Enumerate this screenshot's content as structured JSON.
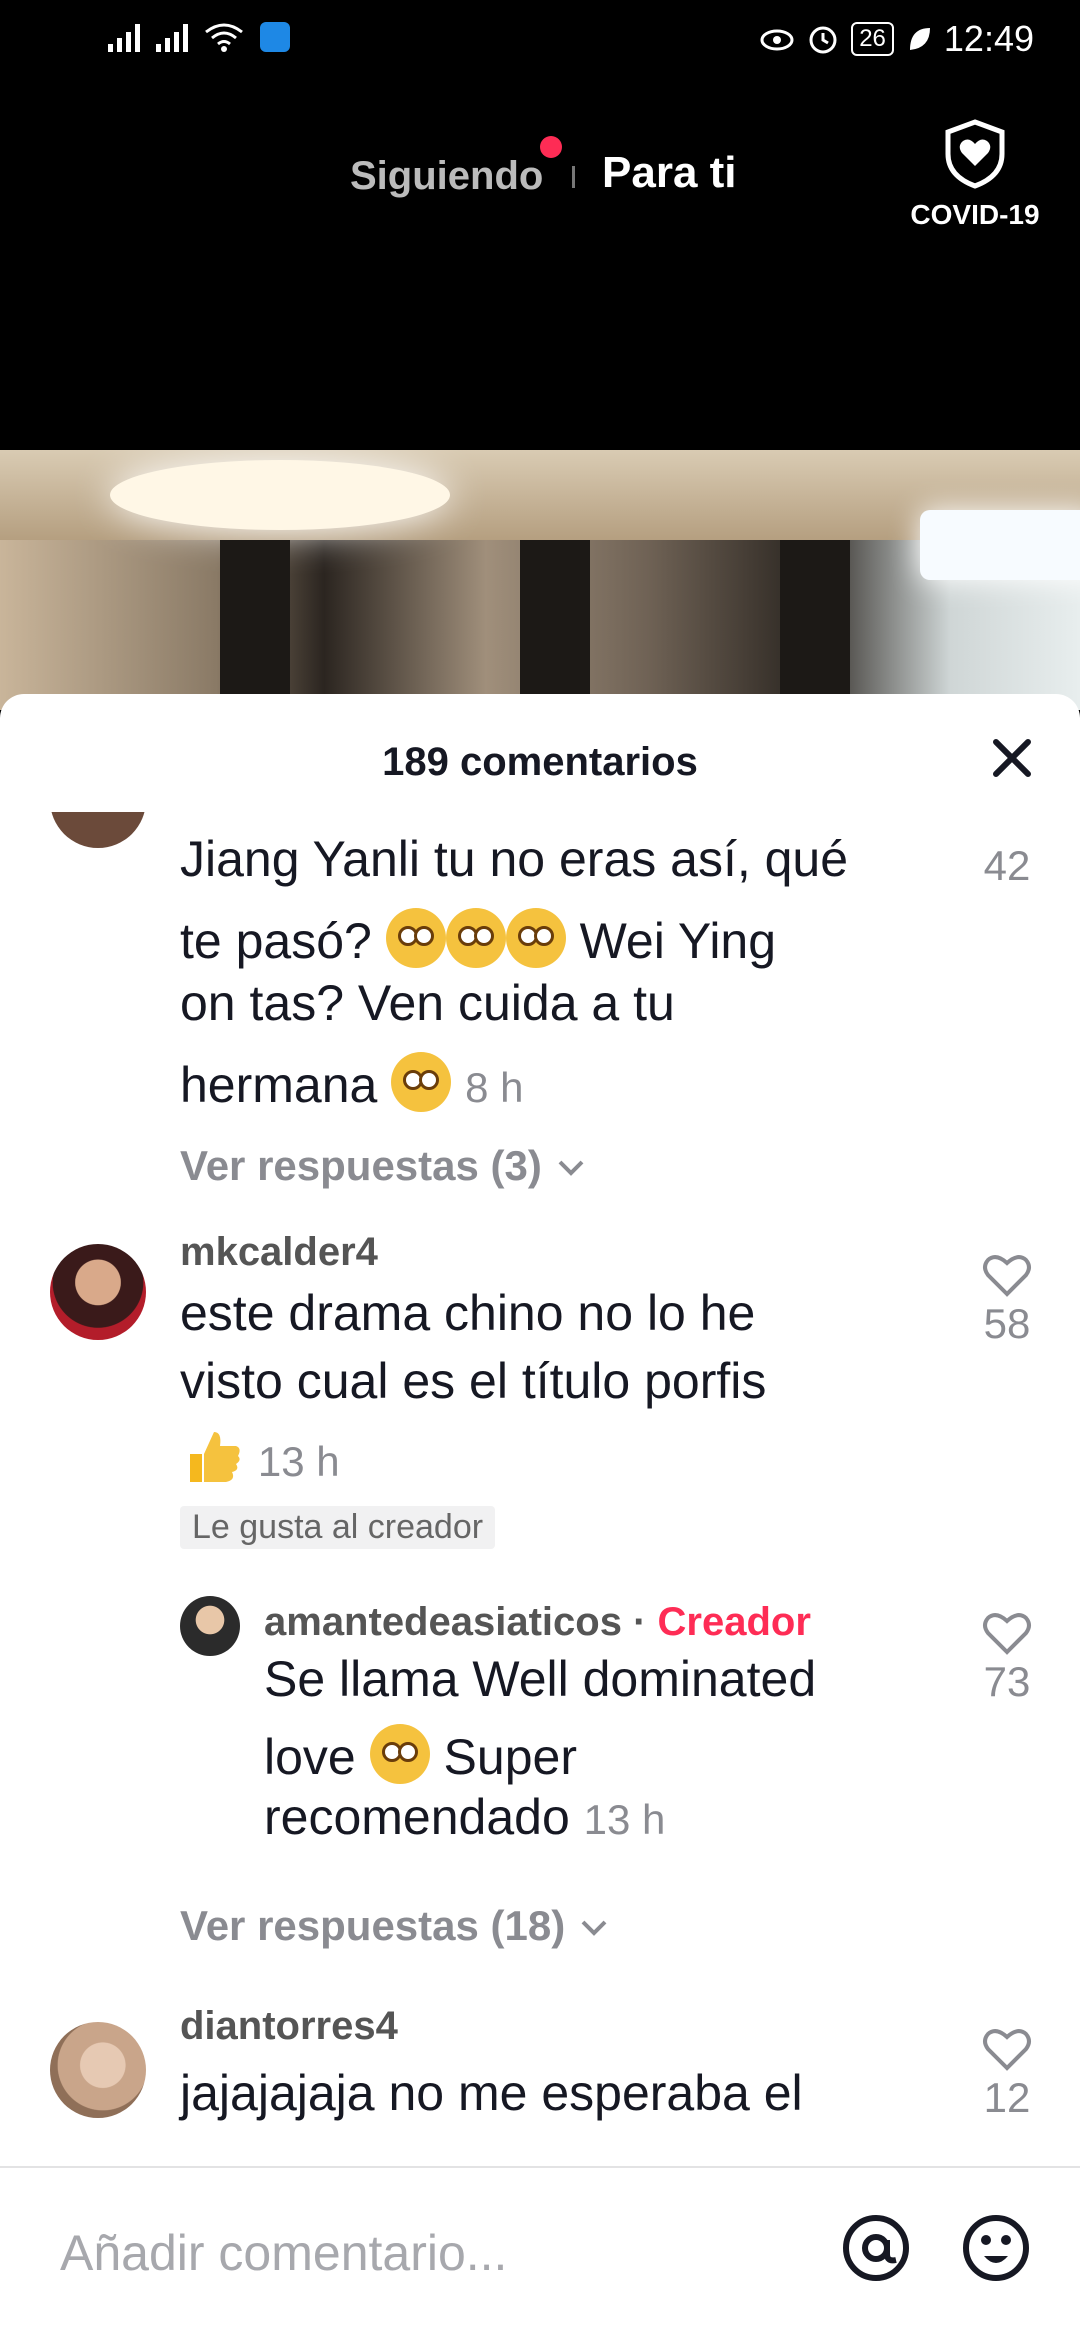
{
  "status_bar": {
    "time": "12:49",
    "battery": "26"
  },
  "top_nav": {
    "following": "Siguiendo",
    "for_you": "Para ti",
    "covid_label": "COVID-19"
  },
  "comments_sheet": {
    "title": "189 comentarios",
    "comments": [
      {
        "text_line1": "Jiang Yanli tu no eras así, qué",
        "text_line2a": "te pasó?",
        "text_line2b": "Wei Ying",
        "text_line3": "on tas? Ven cuida a tu",
        "text_line4": "hermana",
        "time": "8 h",
        "likes": "42",
        "view_replies": "Ver respuestas (3)"
      },
      {
        "username": "mkcalder4",
        "text_line1": "este drama chino no lo he",
        "text_line2": "visto cual es el título porfis",
        "time": "13 h",
        "likes": "58",
        "creator_liked": "Le gusta al creador",
        "reply": {
          "username": "amantedeasiaticos",
          "separator": "·",
          "creator_badge": "Creador",
          "text_line1": "Se llama Well dominated",
          "text_line2a": "love",
          "text_line2b": "Super",
          "text_line3": "recomendado",
          "time": "13 h",
          "likes": "73"
        },
        "view_replies": "Ver respuestas (18)"
      },
      {
        "username": "diantorres4",
        "text_line1": "jajajajaja no me esperaba el",
        "likes": "12"
      }
    ]
  },
  "input": {
    "placeholder": "Añadir comentario..."
  },
  "icons": {
    "covid": "shield-heart-icon",
    "close": "close-icon",
    "like": "heart-outline-icon",
    "mention": "at-icon",
    "emoji": "smile-icon"
  },
  "colors": {
    "accent": "#fe2c55",
    "muted": "#8a8b91"
  }
}
